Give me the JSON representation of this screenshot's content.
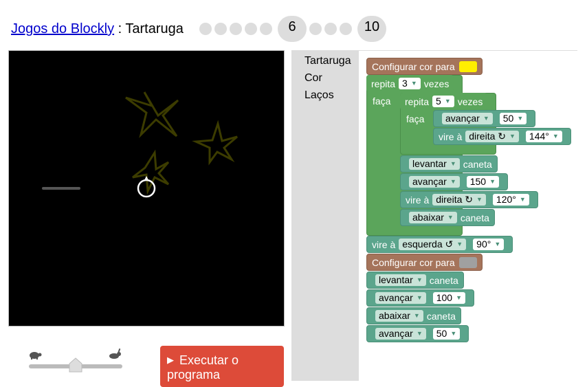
{
  "header": {
    "breadcrumb_link": "Jogos do Blockly",
    "breadcrumb_sep": " : ",
    "breadcrumb_current": "Tartaruga",
    "level_current": "6",
    "level_last": "10"
  },
  "toolbox": {
    "categories": [
      "Tartaruga",
      "Cor",
      "Laços"
    ]
  },
  "controls": {
    "run_label": "Executar o programa"
  },
  "blocks": {
    "set_colour_label": "Configurar cor para",
    "colour_1": "#ffee00",
    "repeat_label": "repita",
    "repeat_outer_count": "3",
    "times_label": "vezes",
    "do_label": "faça",
    "repeat_inner_count": "5",
    "move_forward": "avançar",
    "move_50": "50",
    "turn_label": "vire à",
    "turn_right": "direita ↻",
    "angle_144": "144°",
    "pen_up": "levantar",
    "pen_label": "caneta",
    "move_150": "150",
    "angle_120": "120°",
    "pen_down": "abaixar",
    "turn_left": "esquerda ↺",
    "angle_90": "90°",
    "colour_2": "#a0a0a0",
    "move_100": "100",
    "move_50b": "50"
  },
  "colors": {
    "run_button": "#dd4b39",
    "star_stroke": "#3c3c00",
    "loop_block": "#5ba55b",
    "turtle_block": "#5ba58c",
    "colour_block": "#a5745b"
  },
  "icons": {
    "run": "play-icon",
    "slow": "tortoise-icon",
    "fast": "hare-icon"
  }
}
